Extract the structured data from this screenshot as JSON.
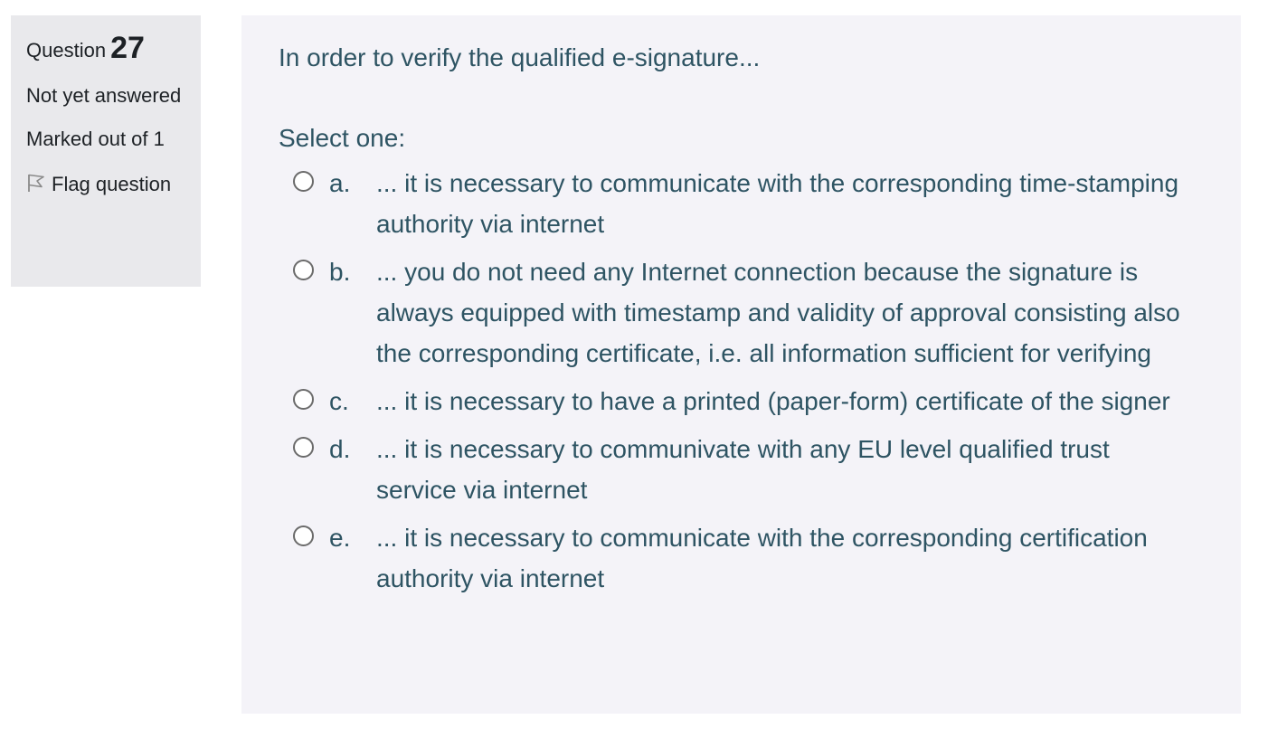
{
  "info": {
    "question_label": "Question",
    "question_number": "27",
    "state": "Not yet answered",
    "grade": "Marked out of 1",
    "flag_label": "Flag question"
  },
  "content": {
    "question_text": "In order to verify the qualified e-signature...",
    "prompt": "Select one:",
    "answers": [
      {
        "letter": "a.",
        "text": "... it is necessary to communicate with the corresponding time-stamping authority via internet",
        "selected": false
      },
      {
        "letter": "b.",
        "text": "... you do not need any Internet connection because the signature is always equipped with timestamp and validity of approval consisting also the corresponding certificate, i.e. all information sufficient for verifying",
        "selected": false
      },
      {
        "letter": "c.",
        "text": "... it is necessary to have a printed (paper-form) certificate of the signer",
        "selected": false
      },
      {
        "letter": "d.",
        "text": "... it is necessary to communivate with any EU level qualified trust service via internet",
        "selected": false
      },
      {
        "letter": "e.",
        "text": "... it is necessary to communicate with the corresponding certification authority via internet",
        "selected": false
      }
    ]
  },
  "colors": {
    "info_background": "#e9e9ec",
    "content_background": "#f4f3f8",
    "question_text": "#2e5463",
    "info_text": "#1d2125"
  },
  "icons": {
    "flag": "flag-outline-icon",
    "radio": "radio-unchecked-icon"
  }
}
